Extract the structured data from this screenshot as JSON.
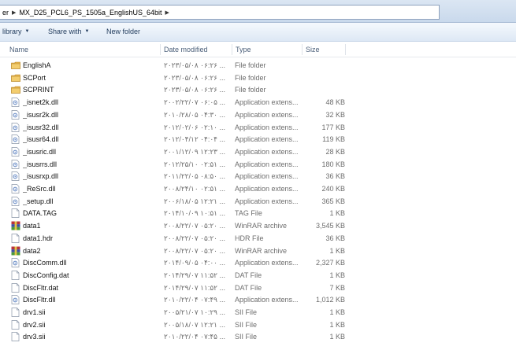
{
  "address": {
    "partial_segment": "er",
    "segment": "MX_D25_PCL6_PS_1505a_EnglishUS_64bit"
  },
  "toolbar": {
    "library_label": "library",
    "share_label": "Share with",
    "newfolder_label": "New folder"
  },
  "columns": {
    "name": "Name",
    "date": "Date modified",
    "type": "Type",
    "size": "Size"
  },
  "files": [
    {
      "name": "EnglishA",
      "date": "۲۰۲۳/۰۵/۰۸ ۰۶:۲۶ ...",
      "type": "File folder",
      "size": "",
      "icon": "folder-icon"
    },
    {
      "name": "SCPort",
      "date": "۲۰۲۳/۰۵/۰۸ ۰۶:۲۶ ...",
      "type": "File folder",
      "size": "",
      "icon": "folder-icon"
    },
    {
      "name": "SCPRINT",
      "date": "۲۰۲۳/۰۵/۰۸ ۰۶:۲۶ ...",
      "type": "File folder",
      "size": "",
      "icon": "folder-icon"
    },
    {
      "name": "_isnet2k.dll",
      "date": "۲۰۰۲/۲۲/۰۷ ۰۶:۰۵ ...",
      "type": "Application extens...",
      "size": "48 KB",
      "icon": "dll-icon"
    },
    {
      "name": "_isusr2k.dll",
      "date": "۲۰۱۰/۲۸/۰۵ ۰۴:۳۰ ...",
      "type": "Application extens...",
      "size": "32 KB",
      "icon": "dll-icon"
    },
    {
      "name": "_isusr32.dll",
      "date": "۲۰۱۲/۰۲/۰۶ ۰۲:۱۰ ...",
      "type": "Application extens...",
      "size": "177 KB",
      "icon": "dll-icon"
    },
    {
      "name": "_isusr64.dll",
      "date": "۲۰۱۲/۰۴/۱۲ ۰۴:۰۴ ...",
      "type": "Application extens...",
      "size": "119 KB",
      "icon": "dll-icon"
    },
    {
      "name": "_isusric.dll",
      "date": "۲۰۰۱/۱۲/۰۹ ۱۲:۲۳ ...",
      "type": "Application extens...",
      "size": "28 KB",
      "icon": "dll-icon"
    },
    {
      "name": "_isusrrs.dll",
      "date": "۲۰۱۲/۲۵/۱۰ ۰۲:۵۱ ...",
      "type": "Application extens...",
      "size": "180 KB",
      "icon": "dll-icon"
    },
    {
      "name": "_isusrxp.dll",
      "date": "۲۰۱۱/۲۲/۰۵ ۰۸:۵۰ ...",
      "type": "Application extens...",
      "size": "36 KB",
      "icon": "dll-icon"
    },
    {
      "name": "_ReSrc.dll",
      "date": "۲۰۰۸/۲۴/۱۰ ۰۲:۵۱ ...",
      "type": "Application extens...",
      "size": "240 KB",
      "icon": "dll-icon"
    },
    {
      "name": "_setup.dll",
      "date": "۲۰۰۶/۱۸/۰۵ ۱۲:۲۱ ...",
      "type": "Application extens...",
      "size": "365 KB",
      "icon": "dll-icon"
    },
    {
      "name": "DATA.TAG",
      "date": "۲۰۱۴/۱۰/۰۹ ۱۰:۵۱ ...",
      "type": "TAG File",
      "size": "1 KB",
      "icon": "file-icon"
    },
    {
      "name": "data1",
      "date": "۲۰۰۸/۲۲/۰۷ ۰۵:۲۰ ...",
      "type": "WinRAR archive",
      "size": "3,545 KB",
      "icon": "winrar-icon"
    },
    {
      "name": "data1.hdr",
      "date": "۲۰۰۸/۲۲/۰۷ ۰۵:۲۰ ...",
      "type": "HDR File",
      "size": "36 KB",
      "icon": "file-icon"
    },
    {
      "name": "data2",
      "date": "۲۰۰۸/۲۲/۰۷ ۰۵:۲۰ ...",
      "type": "WinRAR archive",
      "size": "1 KB",
      "icon": "winrar-icon"
    },
    {
      "name": "DiscComm.dll",
      "date": "۲۰۱۴/۰۹/۰۵ ۰۴:۰۰ ...",
      "type": "Application extens...",
      "size": "2,327 KB",
      "icon": "dll-icon"
    },
    {
      "name": "DiscConfig.dat",
      "date": "۲۰۱۴/۲۹/۰۷ ۱۱:۵۲ ...",
      "type": "DAT File",
      "size": "1 KB",
      "icon": "file-icon"
    },
    {
      "name": "DiscFltr.dat",
      "date": "۲۰۱۴/۲۹/۰۷ ۱۱:۵۲ ...",
      "type": "DAT File",
      "size": "7 KB",
      "icon": "file-icon"
    },
    {
      "name": "DiscFltr.dll",
      "date": "۲۰۱۰/۲۲/۰۴ ۰۷:۴۹ ...",
      "type": "Application extens...",
      "size": "1,012 KB",
      "icon": "dll-icon"
    },
    {
      "name": "drv1.sii",
      "date": "۲۰۰۵/۲۱/۰۷ ۱۰:۲۹ ...",
      "type": "SII File",
      "size": "1 KB",
      "icon": "file-icon"
    },
    {
      "name": "drv2.sii",
      "date": "۲۰۰۵/۱۸/۰۷ ۱۲:۲۱ ...",
      "type": "SII File",
      "size": "1 KB",
      "icon": "file-icon"
    },
    {
      "name": "drv3.sii",
      "date": "۲۰۱۰/۲۲/۰۴ ۰۷:۴۵ ...",
      "type": "SII File",
      "size": "1 KB",
      "icon": "file-icon"
    }
  ],
  "colors": {
    "folder": "#e8b64c",
    "dll": "#6d8fc7",
    "winrar_a": "#b8323c",
    "winrar_b": "#3f4fa3",
    "header_text": "#4c607a"
  }
}
